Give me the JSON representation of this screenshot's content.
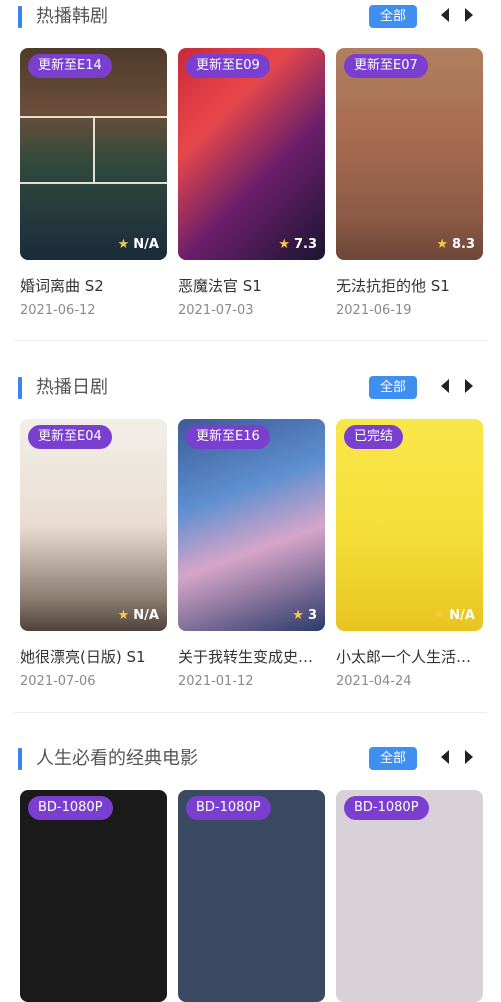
{
  "sections": [
    {
      "title": "热播韩剧",
      "all_label": "全部",
      "cards": [
        {
          "badge": "更新至E14",
          "rating": "N/A",
          "title": "婚词离曲 S2",
          "date": "2021-06-12"
        },
        {
          "badge": "更新至E09",
          "rating": "7.3",
          "title": "恶魔法官 S1",
          "date": "2021-07-03"
        },
        {
          "badge": "更新至E07",
          "rating": "8.3",
          "title": "无法抗拒的他 S1",
          "date": "2021-06-19"
        }
      ]
    },
    {
      "title": "热播日剧",
      "all_label": "全部",
      "cards": [
        {
          "badge": "更新至E04",
          "rating": "N/A",
          "title": "她很漂亮(日版) S1",
          "date": "2021-07-06"
        },
        {
          "badge": "更新至E16",
          "rating": "3",
          "title": "关于我转生变成史…",
          "date": "2021-01-12"
        },
        {
          "badge": "已完结",
          "rating": "N/A",
          "title": "小太郎一个人生活…",
          "date": "2021-04-24"
        }
      ]
    },
    {
      "title": "人生必看的经典电影",
      "all_label": "全部",
      "cards": [
        {
          "badge": "BD-1080P"
        },
        {
          "badge": "BD-1080P"
        },
        {
          "badge": "BD-1080P"
        }
      ]
    }
  ],
  "colors": {
    "accent_bar": "#3b82f6",
    "all_button": "#3f8ff0",
    "badge": "#7b3fd0",
    "star": "#f6c94a"
  },
  "icons": {
    "prev": "triangle-left-icon",
    "next": "triangle-right-icon",
    "star": "star-icon"
  }
}
